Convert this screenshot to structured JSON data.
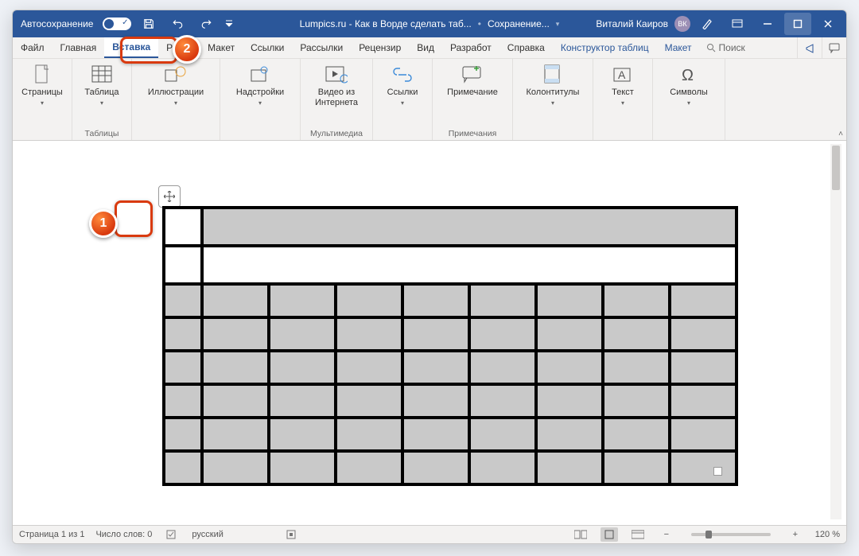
{
  "titlebar": {
    "autosave": "Автосохранение",
    "doc_title": "Lumpics.ru - Как в Ворде сделать таб...",
    "save_state": "Сохранение...",
    "user_name": "Виталий Каиров",
    "user_initials": "ВК"
  },
  "tabs": {
    "items": [
      "Файл",
      "Главная",
      "Вставка",
      "Рисук",
      "Макет",
      "Ссылки",
      "Рассылки",
      "Рецензир",
      "Вид",
      "Разработ",
      "Справка"
    ],
    "context": [
      "Конструктор таблиц",
      "Макет"
    ],
    "search": "Поиск",
    "active_index": 2
  },
  "ribbon": {
    "pages": {
      "label": "Страницы"
    },
    "tables": {
      "cmd": "Таблица",
      "label": "Таблицы"
    },
    "illus": {
      "cmd": "Иллюстрации"
    },
    "addins": {
      "cmd": "Надстройки"
    },
    "media": {
      "cmd": "Видео из Интернета",
      "label": "Мультимедиа"
    },
    "links": {
      "cmd": "Ссылки"
    },
    "comment": {
      "cmd": "Примечание",
      "label": "Примечания"
    },
    "headers": {
      "cmd": "Колонтитулы"
    },
    "text": {
      "cmd": "Текст"
    },
    "symbols": {
      "cmd": "Символы"
    }
  },
  "status": {
    "page": "Страница 1 из 1",
    "words": "Число слов: 0",
    "lang": "русский",
    "zoom": "120 %"
  },
  "callouts": {
    "one": "1",
    "two": "2"
  }
}
